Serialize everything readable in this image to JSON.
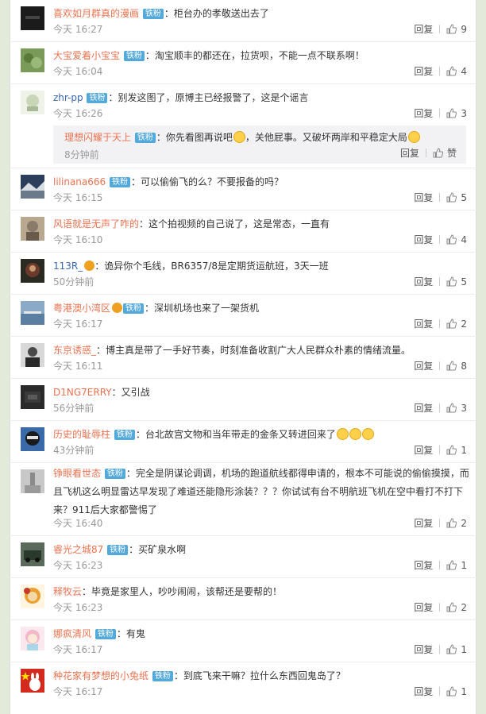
{
  "labels": {
    "reply": "回复",
    "like_word": "赞"
  },
  "colors": {
    "username": "#eb7350",
    "badge": "#53a9d9",
    "background": "#e3ead9"
  },
  "badge_text": "铁粉",
  "comments": [
    {
      "user": "喜欢如月群真的漫画",
      "badge": true,
      "text": "：柜台办的孝敬送出去了",
      "time": "今天 16:27",
      "likes": "9",
      "avatar_color": "#1b1b1b"
    },
    {
      "user": "大宝爱着小宝宝",
      "badge": true,
      "text": "：淘宝顺丰的都还在，拉货呗，不能一点不联系啊！",
      "time": "今天 16:04",
      "likes": "4",
      "avatar_color": "#7a9a5a"
    },
    {
      "user": "zhr-pp",
      "badge": true,
      "text": "：别发这图了，原博主已经报警了，这是个谣言",
      "time": "今天 16:26",
      "likes": "3",
      "avatar_color": "#c9d6b8",
      "reply": {
        "user": "理想闪耀于天上",
        "badge": true,
        "text": "：你先看图再说吧",
        "text2": "，关他屁事。又破坏两岸和平稳定大局",
        "time": "8分钟前",
        "likes": "赞"
      }
    },
    {
      "user": "lilinana666",
      "badge": true,
      "text": "：可以偷偷飞的么？不要报备的吗？",
      "time": "今天 16:15",
      "likes": "5",
      "avatar_color": "#2c3e5c"
    },
    {
      "user": "风语就是无声了咋的",
      "badge": false,
      "text": "：这个拍视频的自己说了，这是常态，一直有",
      "time": "今天 16:10",
      "likes": "4",
      "avatar_color": "#8a7a6a"
    },
    {
      "user": "113R_",
      "badge": false,
      "vip": true,
      "text": "：诡异你个毛线，BR6357/8是定期货运航班，3天一班",
      "time": "50分钟前",
      "likes": "5",
      "avatar_color": "#6b3a2a"
    },
    {
      "user": "粤港澳小湾区",
      "badge": true,
      "vip": true,
      "text": "：深圳机场也来了一架货机",
      "time": "今天 16:17",
      "likes": "2",
      "avatar_color": "#5a7fa0"
    },
    {
      "user": "东京诱惑_",
      "badge": false,
      "text": "：博主真是带了一手好节奏，时刻准备收割广大人民群众朴素的情绪流量。",
      "time": "今天 16:11",
      "likes": "8",
      "avatar_color": "#4a4a4a"
    },
    {
      "user": "D1NG7ERRY",
      "badge": false,
      "text": "：又引战",
      "time": "56分钟前",
      "likes": "3",
      "avatar_color": "#2a2a2a"
    },
    {
      "user": "历史的耻辱柱",
      "badge": true,
      "text": "：台北故宫文物和当年带走的金条又转进回来了",
      "emojis": 3,
      "time": "43分钟前",
      "likes": "1",
      "avatar_color": "#3a6aa8"
    },
    {
      "user": "铮眼看世态",
      "badge": true,
      "text": "：完全是阴谋论调调，机场的跑道航线都得申请的，根本不可能说的偷偷摸摸，而且飞机这么明显雷达早发现了难道还能隐形涂装？？？你试试有台不明航班飞机在空中看打不打下来？911后大家都警惕了",
      "time": "今天 16:40",
      "likes": "2",
      "avatar_color": "#9a9a9a",
      "tall": true
    },
    {
      "user": "睿光之城87",
      "badge": true,
      "text": "：买矿泉水啊",
      "time": "今天 16:23",
      "likes": "1",
      "avatar_color": "#3a4a3a"
    },
    {
      "user": "释牧云",
      "badge": false,
      "text": "：毕竟是家里人，吵吵闹闹，该帮还是要帮的！",
      "time": "今天 16:23",
      "likes": "2",
      "avatar_color": "#e8a030"
    },
    {
      "user": "娜疯清风",
      "badge": true,
      "text": "：有鬼",
      "time": "今天 16:17",
      "likes": "1",
      "avatar_color": "#f0b8c8"
    },
    {
      "user": "种花家有梦想的小兔纸",
      "badge": true,
      "text": "：到底飞来干嘛？拉什么东西回鬼岛了？",
      "time": "今天 16:17",
      "likes": "1",
      "avatar_color": "#d42a1e"
    }
  ]
}
